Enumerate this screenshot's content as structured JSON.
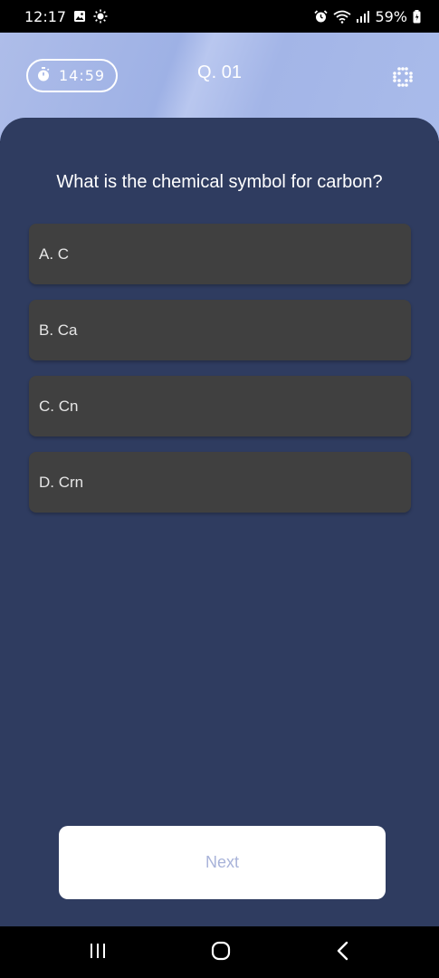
{
  "status_bar": {
    "time": "12:17",
    "battery": "59%",
    "icons": [
      "image-icon",
      "brightness-icon",
      "alarm-icon",
      "wifi-icon",
      "signal-icon",
      "battery-icon"
    ]
  },
  "header": {
    "timer": "14:59",
    "question_number": "Q. 01",
    "icons": [
      "stopwatch-icon",
      "grid-dots-icon"
    ]
  },
  "quiz": {
    "question": "What is the chemical symbol for carbon?",
    "options": [
      {
        "label": "A. C"
      },
      {
        "label": "B. Ca"
      },
      {
        "label": "C. Cn"
      },
      {
        "label": "D. Crn"
      }
    ],
    "next_label": "Next"
  },
  "nav_bar": {
    "icons": [
      "recents-icon",
      "home-icon",
      "back-icon"
    ]
  },
  "colors": {
    "panel": "#2f3c60",
    "option_bg": "#404040",
    "header_bg": "#a5b7e7",
    "next_text": "#a8b3d9"
  }
}
